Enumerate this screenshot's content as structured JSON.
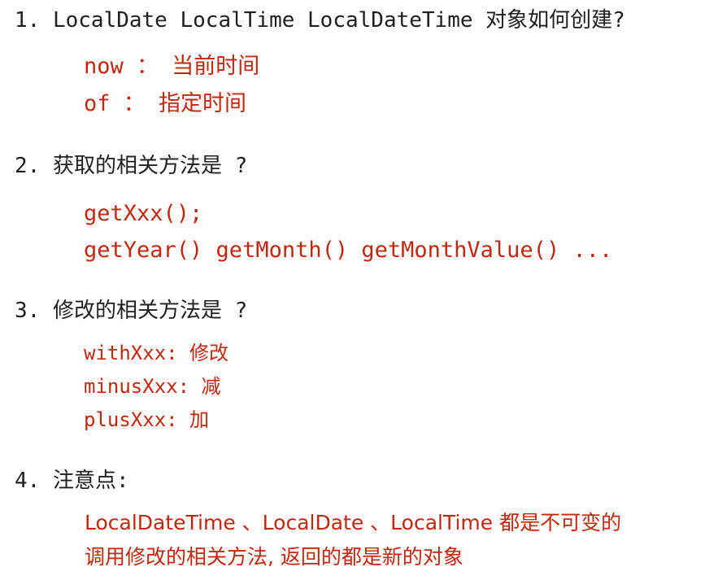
{
  "sections": [
    {
      "heading": "1. LocalDate LocalTime LocalDateTime 对象如何创建?",
      "lines": [
        "now ： 当前时间",
        "of ： 指定时间"
      ]
    },
    {
      "heading": "2. 获取的相关方法是 ?",
      "lines": [
        "getXxx();",
        "getYear() getMonth() getMonthValue() ..."
      ]
    },
    {
      "heading": "3. 修改的相关方法是 ?",
      "lines": [
        "withXxx: 修改",
        "minusXxx: 减",
        "plusXxx: 加"
      ]
    },
    {
      "heading": "4. 注意点:",
      "lines": [
        "LocalDateTime 、LocalDate 、LocalTime 都是不可变的",
        "调用修改的相关方法, 返回的都是新的对象"
      ]
    }
  ],
  "colors": {
    "heading_text": "#1f1f1f",
    "detail_text": "#c0280f",
    "background": "#ffffff"
  }
}
